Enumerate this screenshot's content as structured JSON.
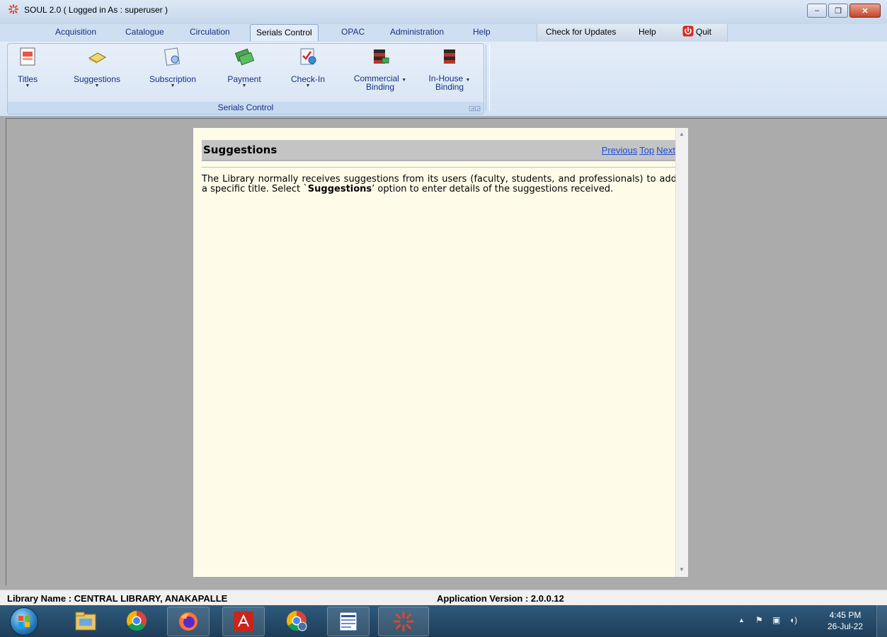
{
  "window": {
    "title": "SOUL 2.0  ( Logged in As : superuser )",
    "controls": {
      "minimize": "‒",
      "maximize": "❐",
      "close": "✕"
    }
  },
  "menu": {
    "tabs": [
      "Acquisition",
      "Catalogue",
      "Circulation",
      "Serials Control",
      "OPAC",
      "Administration",
      "Help"
    ],
    "active_tab": "Serials Control",
    "check_updates": "Check for Updates",
    "help": "Help",
    "quit": "Quit"
  },
  "ribbon": {
    "group_label": "Serials Control",
    "buttons": [
      {
        "label": "Titles",
        "line2": "",
        "icon": "titles-icon",
        "has_dropdown": true
      },
      {
        "label": "Suggestions",
        "line2": "",
        "icon": "suggestions-icon",
        "has_dropdown": true
      },
      {
        "label": "Subscription",
        "line2": "",
        "icon": "subscription-icon",
        "has_dropdown": true
      },
      {
        "label": "Payment",
        "line2": "",
        "icon": "payment-icon",
        "has_dropdown": true
      },
      {
        "label": "Check-In",
        "line2": "",
        "icon": "check-in-icon",
        "has_dropdown": true
      },
      {
        "label": "Commercial",
        "line2": "Binding",
        "icon": "commercial-binding-icon",
        "has_dropdown": true
      },
      {
        "label": "In-House",
        "line2": "Binding",
        "icon": "in-house-binding-icon",
        "has_dropdown": true
      }
    ]
  },
  "help": {
    "title": "Suggestions",
    "nav": {
      "previous": "Previous",
      "top": "Top",
      "next": "Next"
    },
    "body_before": "The Library normally receives suggestions from its users (faculty, students, and professionals) to add a specific title.  Select `",
    "body_bold": "Suggestions",
    "body_after": "’ option to enter details of the suggestions received."
  },
  "status": {
    "library_name": "Library Name : CENTRAL LIBRARY, ANAKAPALLE",
    "app_version": "Application Version : 2.0.0.12"
  },
  "taskbar": {
    "apps": [
      "windows-explorer-icon",
      "chrome-icon",
      "firefox-icon",
      "acrobat-icon",
      "chrome-profile-icon",
      "word-icon",
      "soul-icon"
    ],
    "time": "4:45 PM",
    "date": "26-Jul-22"
  },
  "colors": {
    "accent": "#15317e",
    "help_bg": "#fefce9",
    "link": "#1a4ed6",
    "work_area": "#ababab"
  }
}
